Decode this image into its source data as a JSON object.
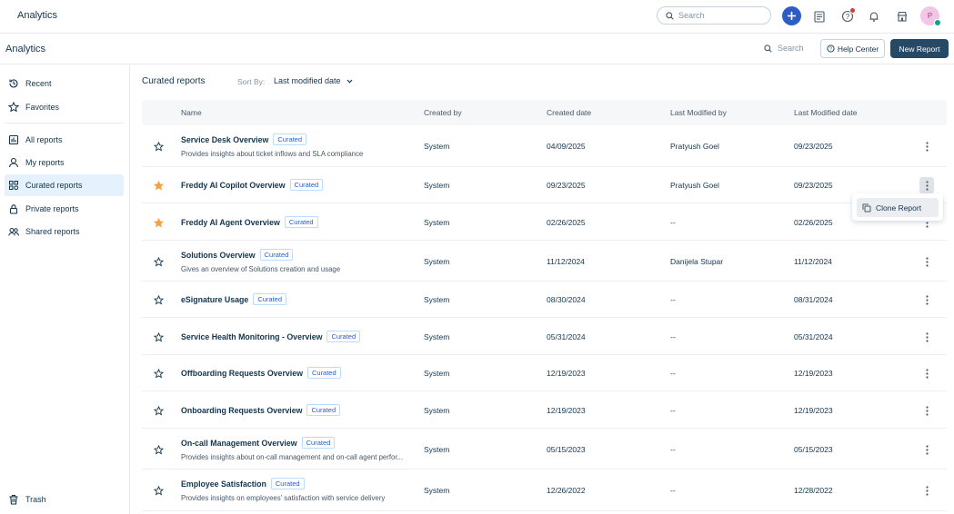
{
  "topbar": {
    "app_title": "Analytics",
    "search_placeholder": "Search",
    "avatar_initial": "P",
    "icons": [
      "plus-icon",
      "tickets-icon",
      "help-icon",
      "bell-icon",
      "apps-icon"
    ],
    "accent_color": "#2c5cc5"
  },
  "subheader": {
    "title": "Analytics",
    "search_placeholder": "Search",
    "help_label": "Help Center",
    "new_report_label": "New Report"
  },
  "sidebar": {
    "items": [
      {
        "label": "Recent",
        "icon": "history-icon"
      },
      {
        "label": "Favorites",
        "icon": "star-icon"
      },
      {
        "label": "All reports",
        "icon": "reports-icon"
      },
      {
        "label": "My reports",
        "icon": "user-icon"
      },
      {
        "label": "Curated reports",
        "icon": "curated-icon",
        "active": true
      },
      {
        "label": "Private reports",
        "icon": "lock-icon"
      },
      {
        "label": "Shared reports",
        "icon": "shared-icon"
      }
    ],
    "trash_label": "Trash"
  },
  "main": {
    "section_title": "Curated reports",
    "sort_label": "Sort By:",
    "sort_value": "Last modified date",
    "columns": [
      "Name",
      "Created by",
      "Created date",
      "Last Modified by",
      "Last Modified date"
    ],
    "tag_label": "Curated",
    "rows": [
      {
        "name": "Service Desk Overview",
        "desc": "Provides insights about ticket inflows and SLA compliance",
        "created_by": "System",
        "created": "04/09/2025",
        "modified_by": "Pratyush Goel",
        "modified": "09/23/2025",
        "favorite": false
      },
      {
        "name": "Freddy AI Copilot Overview",
        "desc": "",
        "created_by": "System",
        "created": "09/23/2025",
        "modified_by": "Pratyush Goel",
        "modified": "09/23/2025",
        "favorite": true,
        "menu_open": true
      },
      {
        "name": "Freddy AI Agent Overview",
        "desc": "",
        "created_by": "System",
        "created": "02/26/2025",
        "modified_by": "--",
        "modified": "02/26/2025",
        "favorite": true
      },
      {
        "name": "Solutions Overview",
        "desc": "Gives an overview of Solutions creation and usage",
        "created_by": "System",
        "created": "11/12/2024",
        "modified_by": "Danijela Stupar",
        "modified": "11/12/2024",
        "favorite": false
      },
      {
        "name": "eSignature Usage",
        "desc": "",
        "created_by": "System",
        "created": "08/30/2024",
        "modified_by": "--",
        "modified": "08/31/2024",
        "favorite": false
      },
      {
        "name": "Service Health Monitoring - Overview",
        "desc": "",
        "created_by": "System",
        "created": "05/31/2024",
        "modified_by": "--",
        "modified": "05/31/2024",
        "favorite": false
      },
      {
        "name": "Offboarding Requests Overview",
        "desc": "",
        "created_by": "System",
        "created": "12/19/2023",
        "modified_by": "--",
        "modified": "12/19/2023",
        "favorite": false
      },
      {
        "name": "Onboarding Requests Overview",
        "desc": "",
        "created_by": "System",
        "created": "12/19/2023",
        "modified_by": "--",
        "modified": "12/19/2023",
        "favorite": false
      },
      {
        "name": "On-call Management Overview",
        "desc": "Provides insights about on-call management and on-call agent perfor...",
        "created_by": "System",
        "created": "05/15/2023",
        "modified_by": "--",
        "modified": "05/15/2023",
        "favorite": false
      },
      {
        "name": "Employee Satisfaction",
        "desc": "Provides insights on employees' satisfaction with service delivery",
        "created_by": "System",
        "created": "12/26/2022",
        "modified_by": "--",
        "modified": "12/28/2022",
        "favorite": false
      }
    ],
    "context_menu": {
      "item_label": "Clone Report",
      "icon": "copy-icon"
    },
    "favorite_color": "#f5a142"
  }
}
